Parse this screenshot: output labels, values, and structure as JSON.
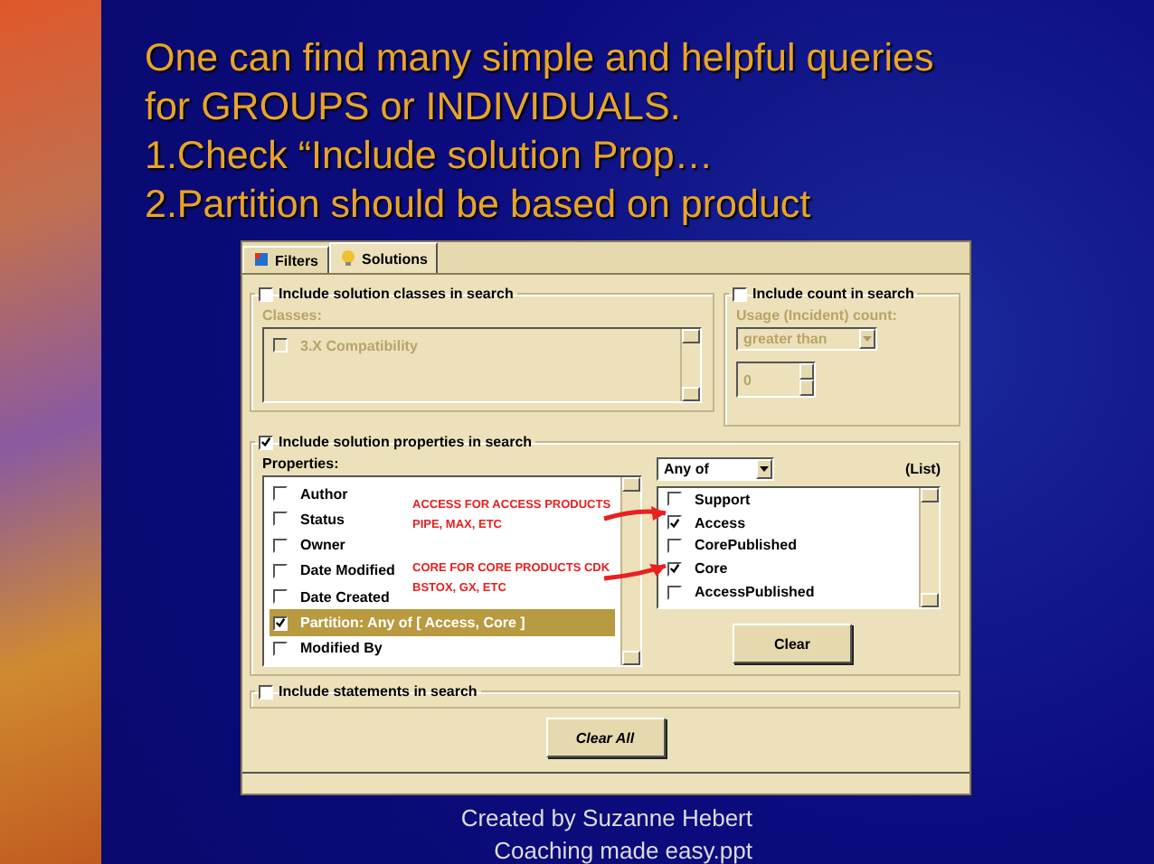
{
  "title_lines": [
    "One can find many simple and helpful queries",
    "for GROUPS or INDIVIDUALS.",
    "1.Check “Include solution Prop…",
    "2.Partition should be based on product"
  ],
  "dialog": {
    "tabs": [
      {
        "label": "Filters",
        "selected": false
      },
      {
        "label": "Solutions",
        "selected": true
      }
    ],
    "classes_group": {
      "label": "Include solution classes in search",
      "checked": false,
      "list_label": "Classes:",
      "items": [
        {
          "label": "3.X Compatibility",
          "checked": false
        }
      ]
    },
    "count_group": {
      "label": "Include count in search",
      "checked": false,
      "list_label": "Usage (Incident) count:",
      "dropdown": "greater than",
      "spinner": "0"
    },
    "properties_group": {
      "label": "Include solution properties in search",
      "checked": true,
      "list_label": "Properties:",
      "items": [
        {
          "label": "Author",
          "checked": false,
          "selected": false
        },
        {
          "label": "Status",
          "checked": false,
          "selected": false
        },
        {
          "label": "Owner",
          "checked": false,
          "selected": false
        },
        {
          "label": "Date Modified",
          "checked": false,
          "selected": false
        },
        {
          "label": "Date Created",
          "checked": false,
          "selected": false
        },
        {
          "label": "Partition: Any of [ Access, Core ]",
          "checked": true,
          "selected": true
        },
        {
          "label": "Modified By",
          "checked": false,
          "selected": false
        }
      ],
      "operator": "Any of",
      "list_caption": "(List)",
      "values": [
        {
          "label": "Support",
          "checked": false
        },
        {
          "label": "Access",
          "checked": true
        },
        {
          "label": "CorePublished",
          "checked": false
        },
        {
          "label": "Core",
          "checked": true
        },
        {
          "label": "AccessPublished",
          "checked": false
        }
      ],
      "clear_button": "Clear"
    },
    "statements_group": {
      "label": "Include statements in search",
      "checked": false
    },
    "clear_all_button": "Clear All",
    "annotations": [
      {
        "lines": [
          "ACCESS FOR ACCESS PRODUCTS",
          "PIPE, MAX, ETC"
        ]
      },
      {
        "lines": [
          "CORE FOR CORE PRODUCTS CDK",
          "BSTOX, GX, ETC"
        ]
      }
    ]
  },
  "footer_lines": [
    "Created by Suzanne Hebert",
    "Coaching made easy.ppt"
  ]
}
